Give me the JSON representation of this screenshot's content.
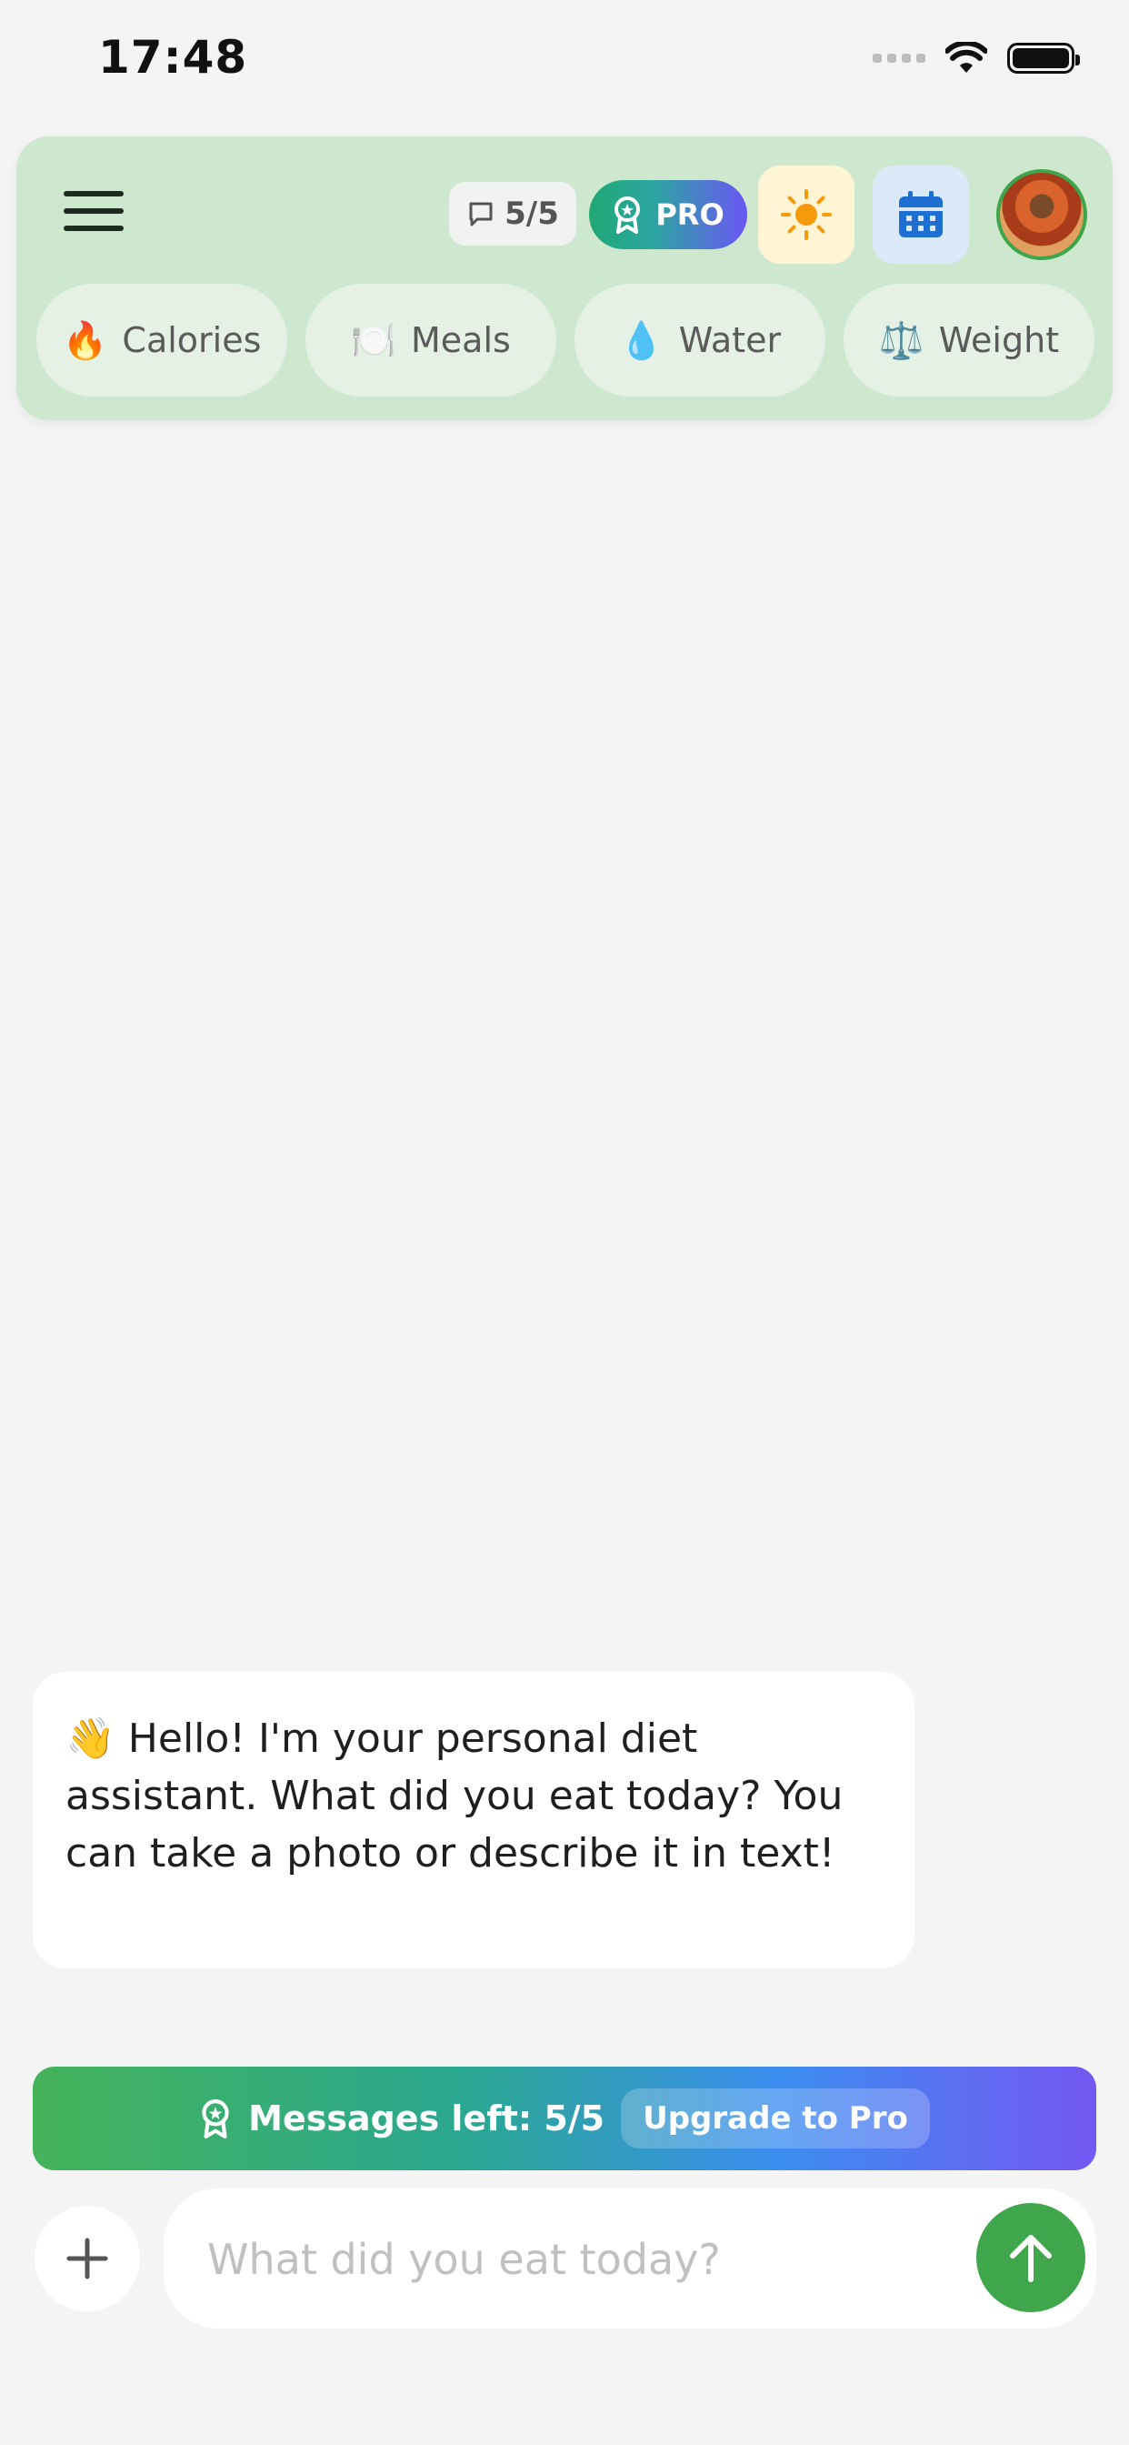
{
  "status_bar": {
    "time": "17:48"
  },
  "header": {
    "message_counter": "5/5",
    "pro_label": "PRO",
    "chips": [
      {
        "emoji": "🔥",
        "label": "Calories"
      },
      {
        "emoji": "🍽️",
        "label": "Meals"
      },
      {
        "emoji": "💧",
        "label": "Water"
      },
      {
        "emoji": "⚖️",
        "label": "Weight"
      }
    ]
  },
  "chat": {
    "messages": [
      {
        "role": "assistant",
        "emoji": "👋",
        "text": "Hello! I'm your personal diet assistant. What did you eat today? You can take a photo or describe it in text!"
      }
    ]
  },
  "upgrade_bar": {
    "messages_left": "Messages left: 5/5",
    "upgrade_label": "Upgrade to Pro"
  },
  "composer": {
    "placeholder": "What did you eat today?",
    "value": ""
  },
  "colors": {
    "header_bg": "#cde8cf",
    "accent_green": "#3fa64c",
    "pro_gradient_start": "#1fa875",
    "pro_gradient_end": "#6a56f5"
  }
}
